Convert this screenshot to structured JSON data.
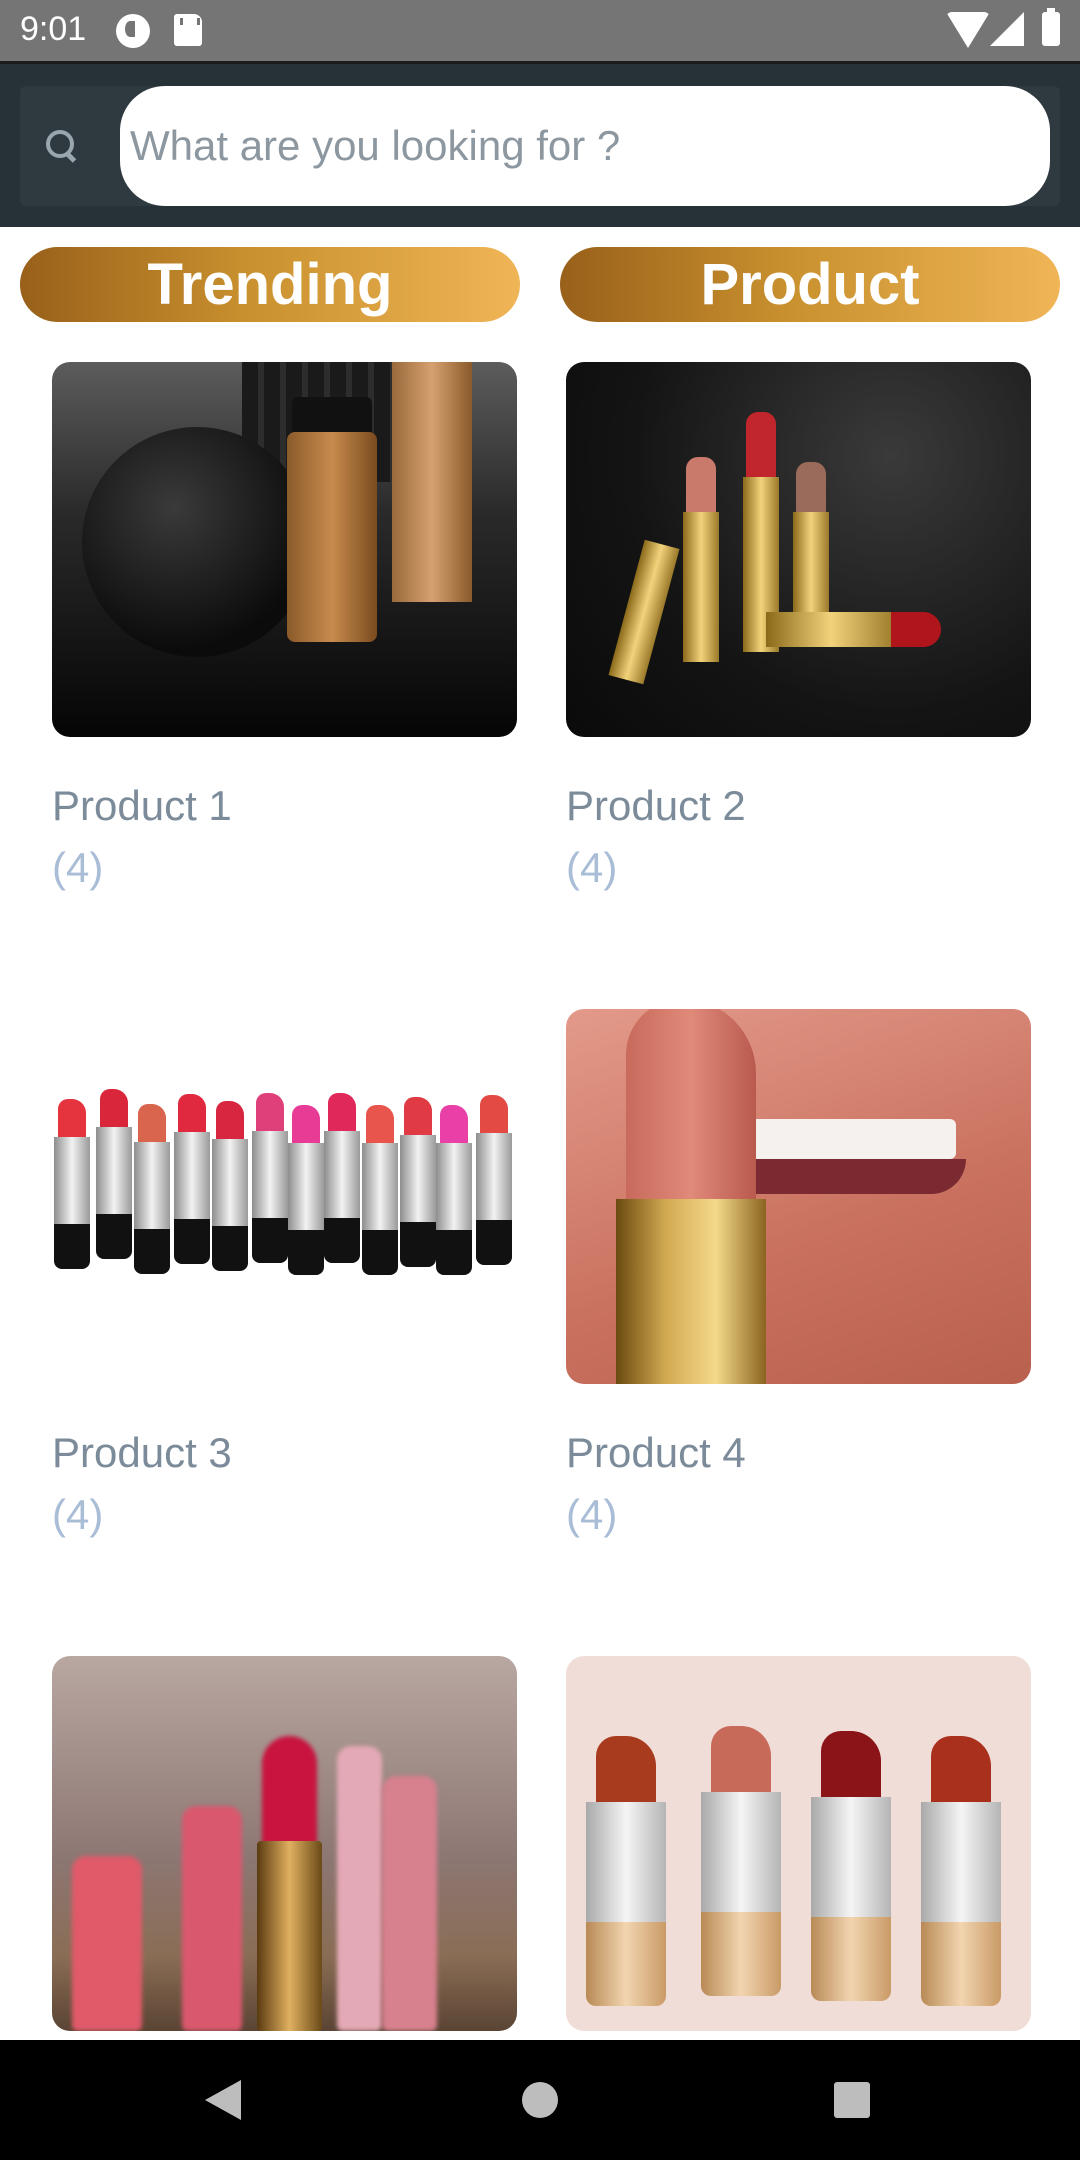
{
  "status_bar": {
    "time": "9:01",
    "icons": [
      "app-notification-icon",
      "sd-card-icon",
      "wifi-icon",
      "signal-icon",
      "battery-icon"
    ]
  },
  "search": {
    "placeholder": "What are you looking for ?",
    "icon": "search-icon"
  },
  "sections": {
    "trending_label": "Trending",
    "product_label": "Product"
  },
  "products": [
    {
      "name": "Product 1",
      "count": "(4)",
      "image": "mac-cosmetics-photo"
    },
    {
      "name": "Product 2",
      "count": "(4)",
      "image": "gold-lipsticks-photo"
    },
    {
      "name": "Product 3",
      "count": "(4)",
      "image": "lipstick-row-photo"
    },
    {
      "name": "Product 4",
      "count": "(4)",
      "image": "lips-lipstick-photo"
    },
    {
      "name": "",
      "count": "",
      "image": "blurred-lipsticks-photo"
    },
    {
      "name": "",
      "count": "",
      "image": "pink-lipsticks-photo"
    }
  ],
  "colors": {
    "app_bar": "#263238",
    "pill_gradient_start": "#98601a",
    "pill_gradient_end": "#efb556",
    "product_name": "#7b8b9a",
    "product_count": "#a9bdd6"
  },
  "nav_bar": {
    "icons": [
      "back-icon",
      "home-icon",
      "recents-icon"
    ]
  }
}
